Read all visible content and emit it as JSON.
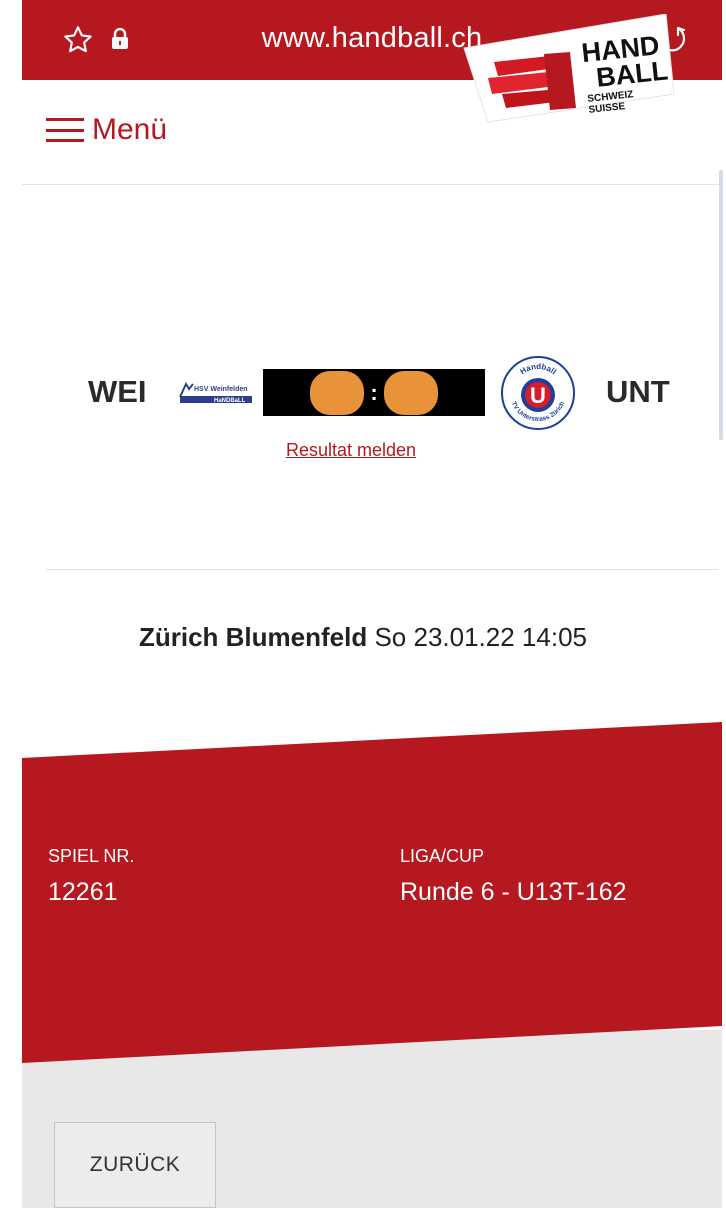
{
  "browser": {
    "url": "www.handball.ch",
    "icons": {
      "bookmark": "star-icon",
      "secure": "lock-icon",
      "reload": "reload-icon"
    }
  },
  "header": {
    "menu_label": "Menü",
    "logo": {
      "line1": "HAND",
      "line2": "BALL",
      "line3": "SCHWEIZ",
      "line4": "SUISSE"
    }
  },
  "match": {
    "home": {
      "abbr": "WEI",
      "logo_text_1": "HSV Weinfelden",
      "logo_text_2": "HaNDBaLL"
    },
    "away": {
      "abbr": "UNT",
      "logo_text_top": "Handball",
      "logo_letter": "U",
      "logo_text_bottom": "TV Unterstrass Zürich"
    },
    "score_separator": ":",
    "report_link": "Resultat melden"
  },
  "venue": {
    "name": "Zürich Blumenfeld",
    "datetime": "So 23.01.22 14:05"
  },
  "details": {
    "game_no_label": "SPIEL NR.",
    "game_no": "12261",
    "league_label": "LIGA/CUP",
    "league": "Runde 6 - U13T-162"
  },
  "footer": {
    "back_label": "ZURÜCK"
  },
  "colors": {
    "brand_red": "#b5191f",
    "score_blob": "#e8923a",
    "footer_grey": "#e8e8e8"
  }
}
